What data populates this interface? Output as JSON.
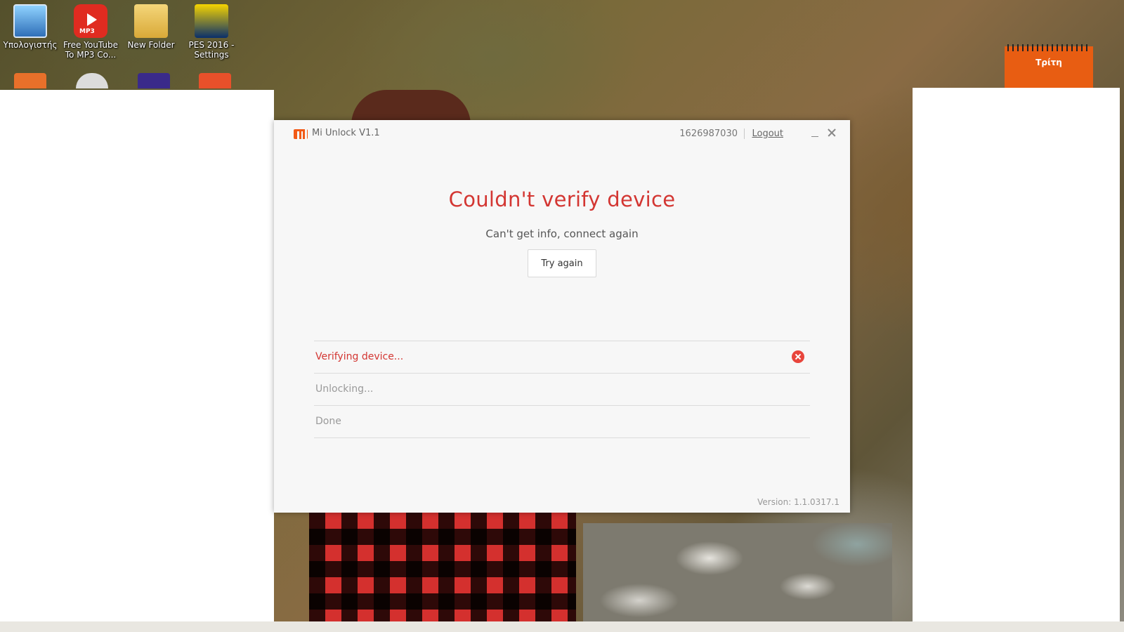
{
  "desktop": {
    "icons": [
      {
        "label": "Υπολογιστής",
        "icon": "computer-icon"
      },
      {
        "label": "Free YouTube To MP3 Co...",
        "icon": "youtube-mp3-icon",
        "badge": "MP3"
      },
      {
        "label": "New Folder",
        "icon": "folder-icon"
      },
      {
        "label": "PES 2016 - Settings",
        "icon": "pes-icon"
      }
    ],
    "calendar": {
      "day": "Τρίτη",
      "icon": "calendar-icon"
    }
  },
  "window": {
    "app_title": "Mi Unlock  V1.1",
    "account_id": "1626987030",
    "logout_label": "Logout",
    "error_title": "Couldn't verify device",
    "error_subtitle": "Can't get info, connect again",
    "try_again_label": "Try again",
    "steps": [
      {
        "label": "Verifying device...",
        "status": "error"
      },
      {
        "label": "Unlocking...",
        "status": "pending"
      },
      {
        "label": "Done",
        "status": "pending"
      }
    ],
    "version": "Version: 1.1.0317.1"
  },
  "colors": {
    "accent_error": "#d33632",
    "mi_brand": "#f25a16",
    "calendar": "#e85d12"
  }
}
